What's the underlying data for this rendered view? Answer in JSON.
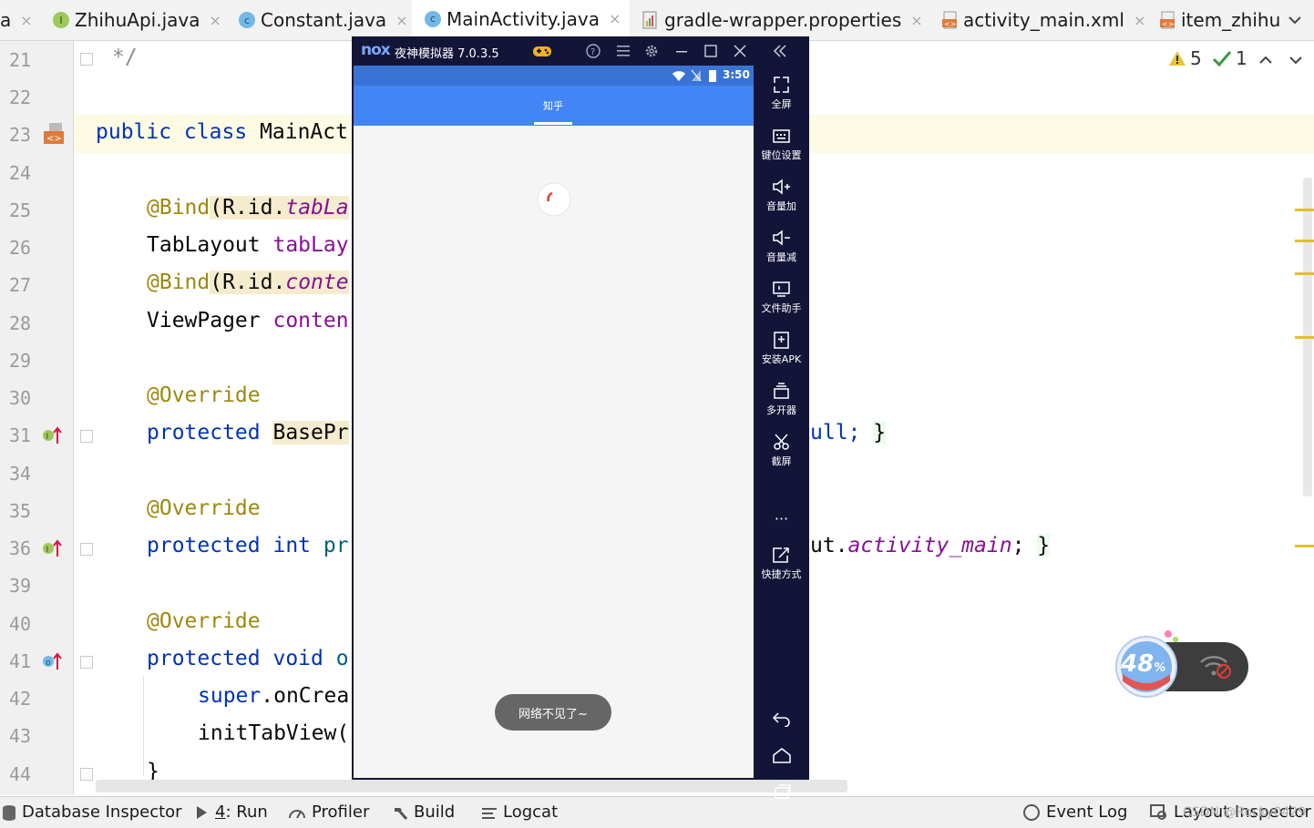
{
  "tabs": [
    {
      "label": "a",
      "close": "×"
    },
    {
      "label": "ZhihuApi.java",
      "close": "×",
      "icon": "interface-icon"
    },
    {
      "label": "Constant.java",
      "close": "×",
      "icon": "class-icon"
    },
    {
      "label": "MainActivity.java",
      "close": "×",
      "icon": "class-icon",
      "active": true
    },
    {
      "label": "gradle-wrapper.properties",
      "close": "×",
      "icon": "properties-file-icon"
    },
    {
      "label": "activity_main.xml",
      "close": "×",
      "icon": "xml-file-icon"
    },
    {
      "label": "item_zhihu",
      "icon": "xml-file-icon"
    }
  ],
  "line_numbers": [
    "21",
    "22",
    "23",
    "24",
    "25",
    "26",
    "27",
    "28",
    "29",
    "30",
    "31",
    "34",
    "35",
    "36",
    "39",
    "40",
    "41",
    "42",
    "43",
    "44"
  ],
  "code": {
    "l21": "*/",
    "l23_kw": "public class",
    "l23_name": "MainAct",
    "l25_ann": "@Bind",
    "l25_ref": "(R.id.",
    "l25_fld": "tabLa",
    "l26_type": "TabLayout",
    "l26_fld": "tabLay",
    "l27_ann": "@Bind",
    "l27_ref": "(R.id.",
    "l27_fld": "conte",
    "l28_type": "ViewPager",
    "l28_fld": "conten",
    "l30_ann": "@Override",
    "l31_kw": "protected",
    "l31_type": "BasePr",
    "l31_tail": "ull;",
    "l31_brace": "}",
    "l35_ann": "@Override",
    "l36_kw": "protected int",
    "l36_name": "pr",
    "l36_tail_a": "ut.",
    "l36_tail_b": "activity_main",
    "l36_tail_c": ";",
    "l36_brace": "}",
    "l40_ann": "@Override",
    "l41_kw": "protected void",
    "l41_name": "o",
    "l42_kw": "super",
    "l42_rest": ".onCrea",
    "l43": "initTabView(",
    "l44": "}"
  },
  "inspections": {
    "warnings": "5",
    "ok": "1"
  },
  "bottom_bar": {
    "database_inspector": "Database Inspector",
    "run_num": "4",
    "run_label": ": Run",
    "profiler": "Profiler",
    "build": "Build",
    "logcat": "Logcat",
    "event_log": "Event Log",
    "layout_inspector": "Layout Inspector",
    "watermark": "CSDN @Rocky0429"
  },
  "emulator": {
    "logo": "nox",
    "title": "夜神模拟器 7.0.3.5",
    "time": "3:50",
    "app_tab": "知乎",
    "toast": "网络不见了~",
    "sidebar": [
      {
        "label": "全屏",
        "icon": "fullscreen-icon"
      },
      {
        "label": "键位设置",
        "icon": "keyboard-icon"
      },
      {
        "label": "音量加",
        "icon": "volume-up-icon"
      },
      {
        "label": "音量减",
        "icon": "volume-down-icon"
      },
      {
        "label": "文件助手",
        "icon": "file-assistant-icon"
      },
      {
        "label": "安装APK",
        "icon": "install-apk-icon"
      },
      {
        "label": "多开器",
        "icon": "multi-instance-icon"
      },
      {
        "label": "截屏",
        "icon": "screenshot-icon"
      },
      {
        "label": "快捷方式",
        "icon": "shortcut-icon"
      }
    ],
    "more": "···"
  },
  "widget": {
    "percent": "48",
    "unit": "%"
  }
}
